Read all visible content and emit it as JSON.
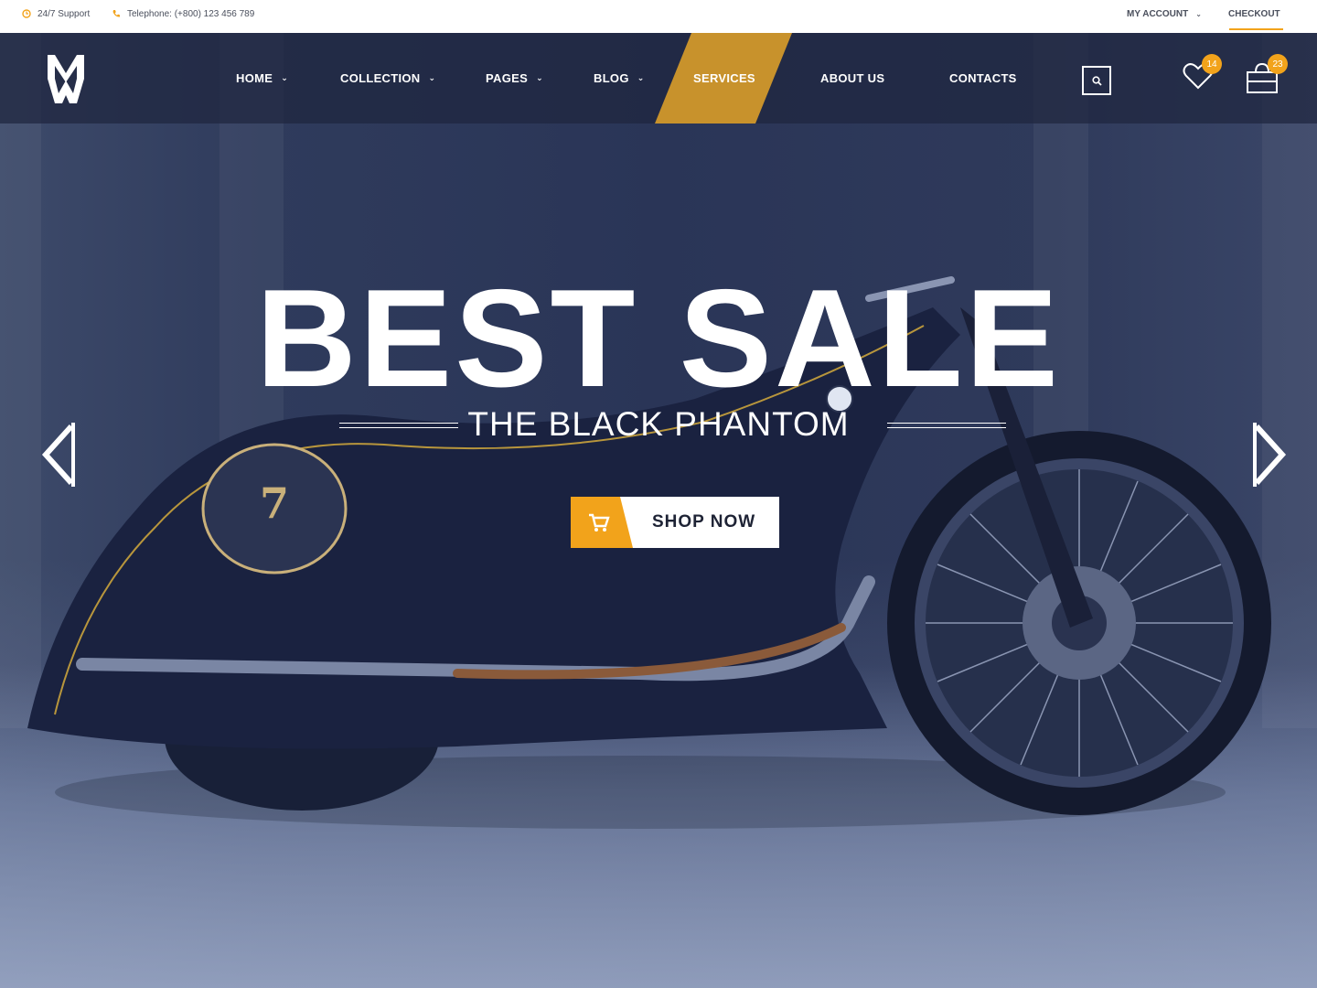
{
  "topbar": {
    "support": "24/7 Support",
    "phone": "Telephone: (+800) 123 456 789",
    "account": "MY ACCOUNT",
    "checkout": "CHECKOUT"
  },
  "nav": {
    "items": [
      {
        "label": "HOME",
        "dropdown": true
      },
      {
        "label": "COLLECTION",
        "dropdown": true
      },
      {
        "label": "PAGES",
        "dropdown": true
      },
      {
        "label": "BLOG",
        "dropdown": true
      },
      {
        "label": "SERVICES",
        "dropdown": false,
        "active": true
      },
      {
        "label": "ABOUT US",
        "dropdown": false
      },
      {
        "label": "CONTACTS",
        "dropdown": false
      }
    ],
    "wishlist_count": "14",
    "cart_count": "23"
  },
  "hero": {
    "title": "BEST SALE",
    "subtitle": "THE BLACK PHANTOM",
    "button_label": "SHOP NOW"
  },
  "colors": {
    "accent": "#f2a31b",
    "active_nav": "#c8922c",
    "nav_bg": "#1e263e",
    "text_dark": "#1e2335"
  },
  "icons": [
    "clock-icon",
    "phone-icon",
    "chevron-down-icon",
    "search-icon",
    "heart-icon",
    "shopping-bag-icon",
    "cart-icon",
    "arrow-left-icon",
    "arrow-right-icon"
  ]
}
